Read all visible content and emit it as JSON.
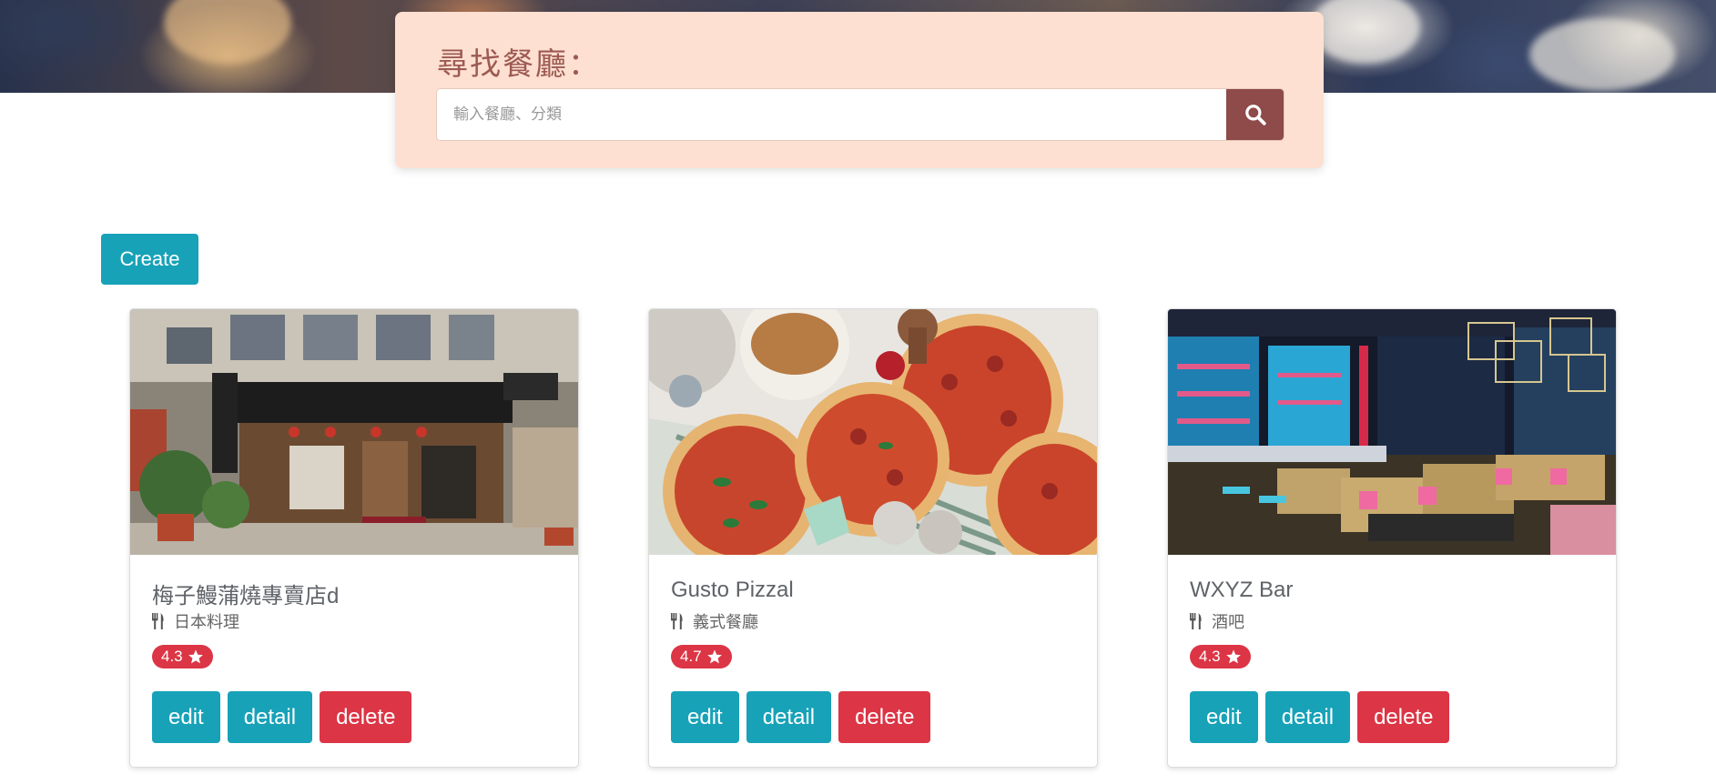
{
  "search": {
    "title": "尋找餐廳：",
    "placeholder": "輸入餐廳、分類"
  },
  "toolbar": {
    "create_label": "Create"
  },
  "colors": {
    "search_panel_bg": "#fde0d1",
    "search_button": "#8f4a4a",
    "info": "#17a2b8",
    "danger": "#dc3545"
  },
  "restaurants": [
    {
      "name": "梅子鰻蒲燒專賣店d",
      "category": "日本料理",
      "rating": "4.3",
      "edit_label": "edit",
      "detail_label": "detail",
      "delete_label": "delete"
    },
    {
      "name": "Gusto Pizzal",
      "category": "義式餐廳",
      "rating": "4.7",
      "edit_label": "edit",
      "detail_label": "detail",
      "delete_label": "delete"
    },
    {
      "name": "WXYZ Bar",
      "category": "酒吧",
      "rating": "4.3",
      "edit_label": "edit",
      "detail_label": "detail",
      "delete_label": "delete"
    }
  ],
  "icons": {
    "search": "search-icon",
    "category": "utensils-icon",
    "rating": "star-icon"
  }
}
